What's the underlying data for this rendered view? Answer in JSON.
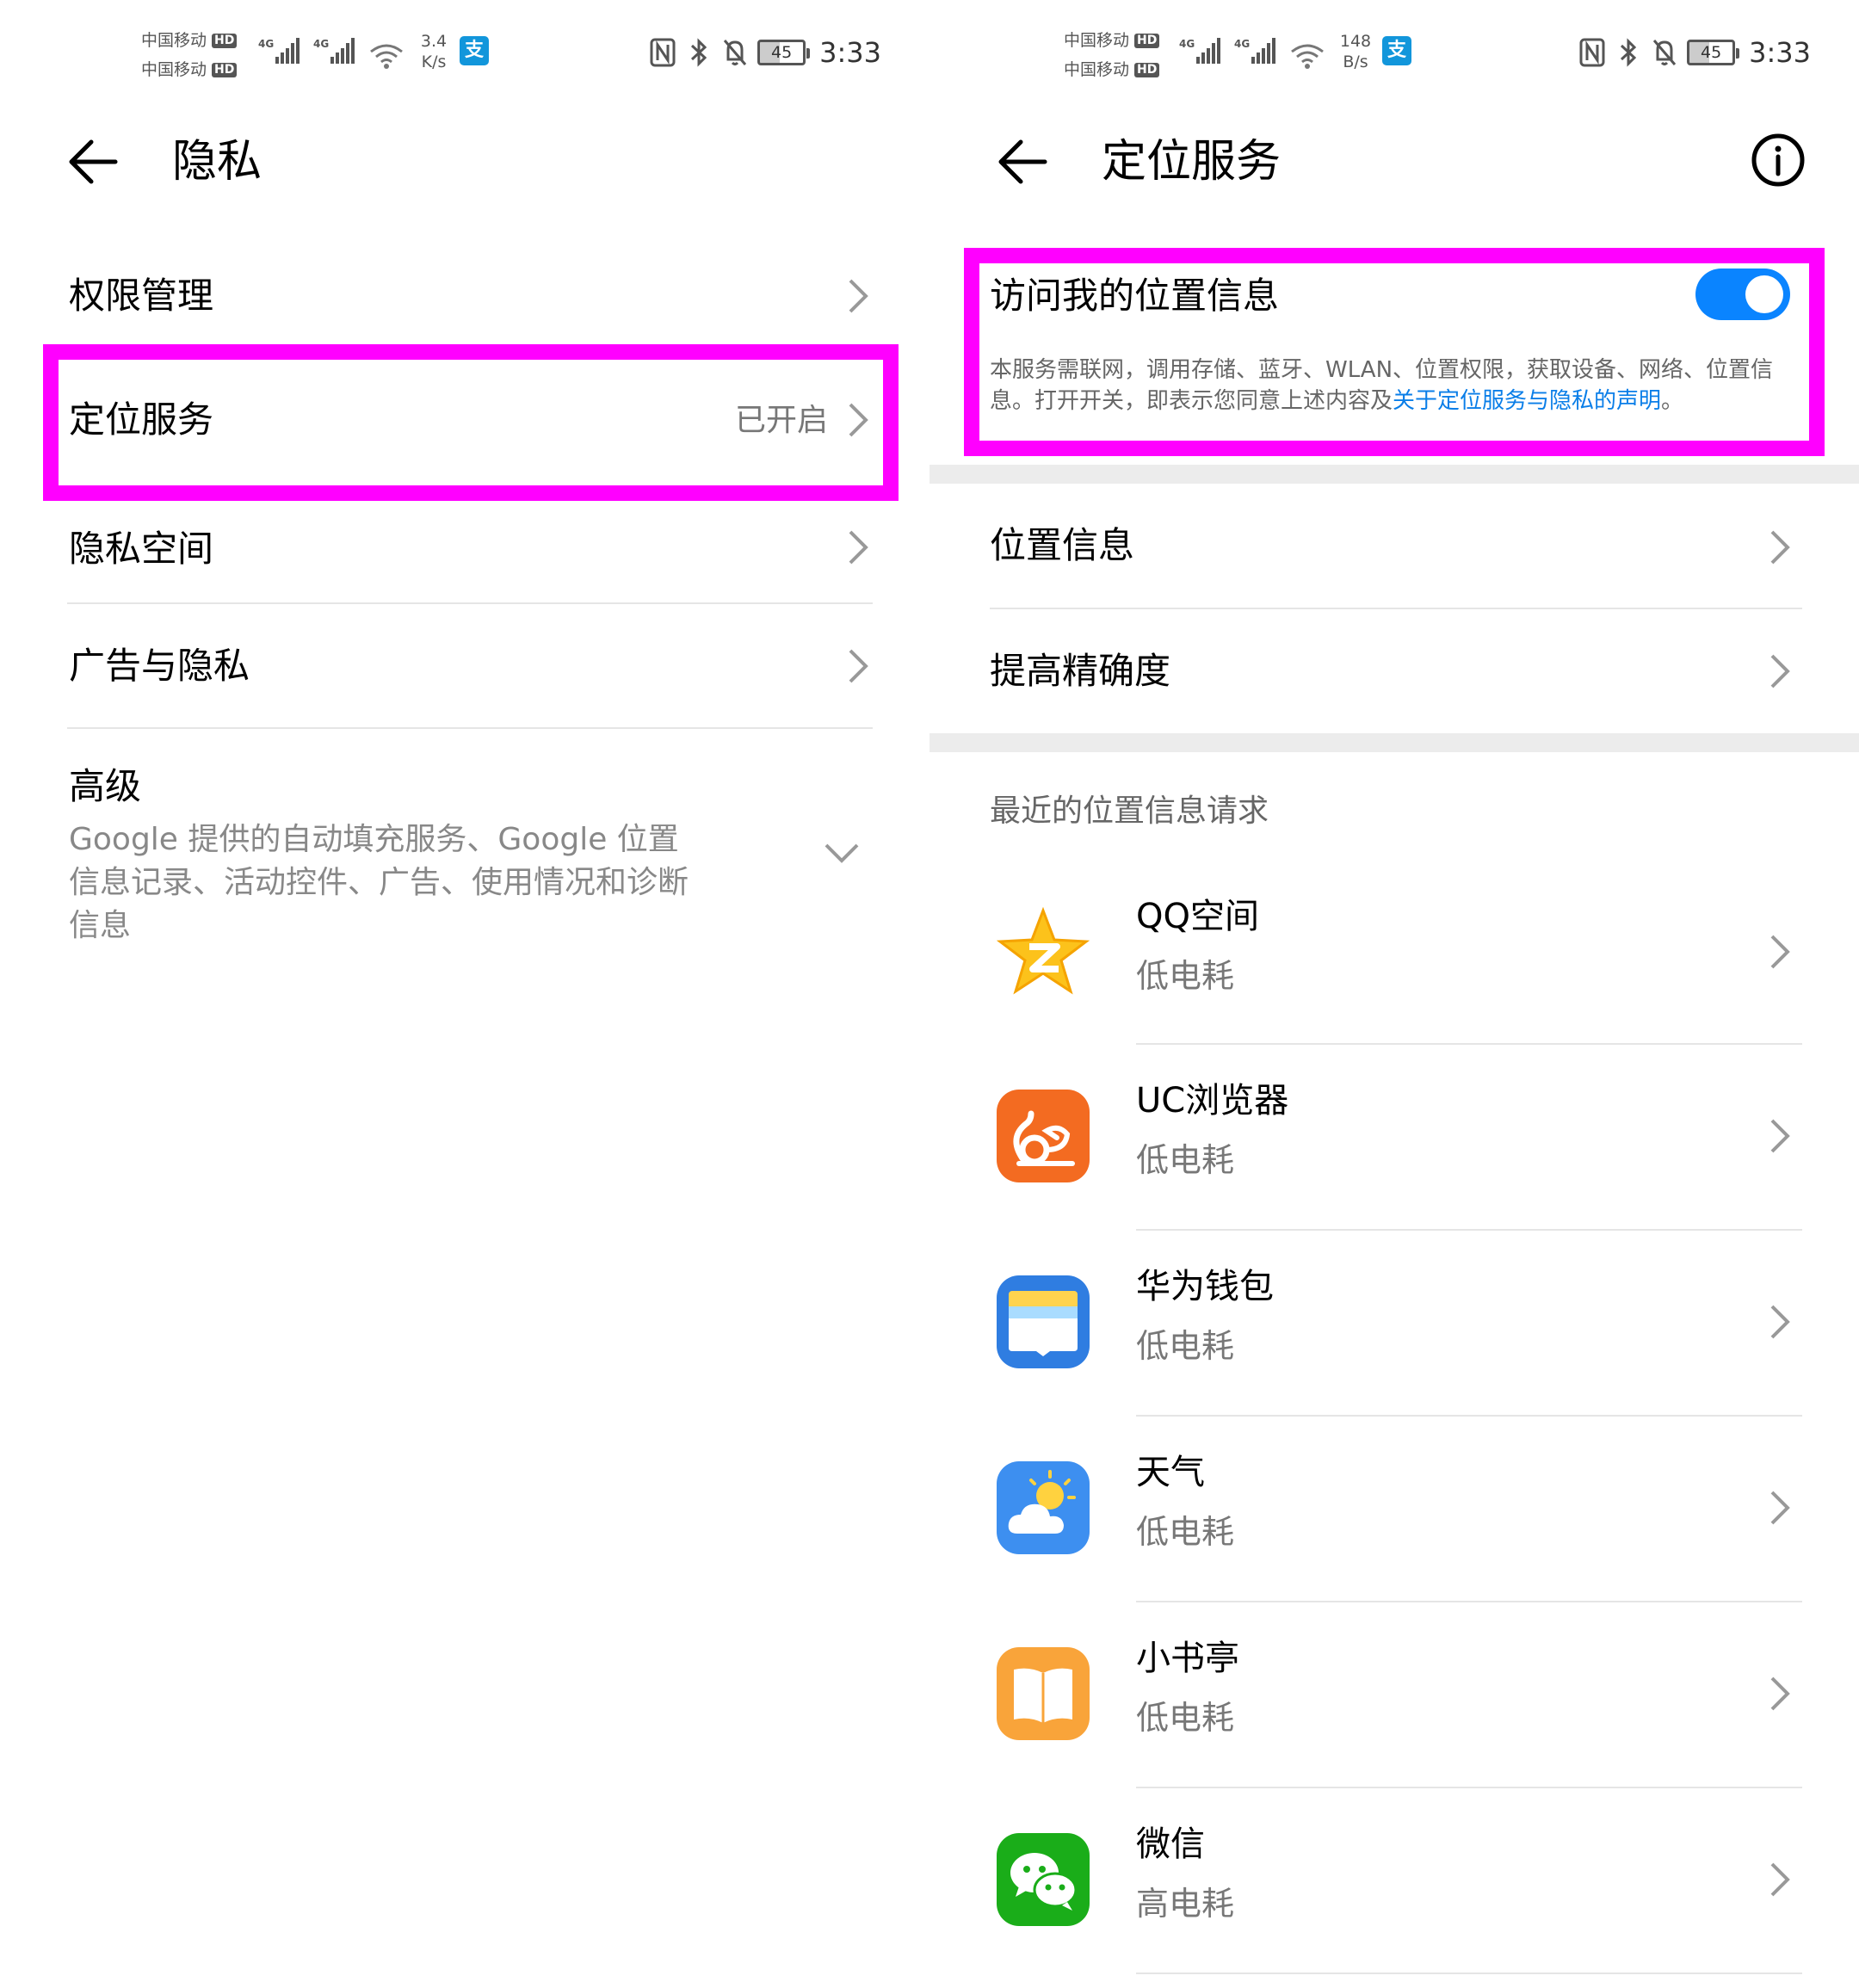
{
  "left": {
    "status": {
      "carrier1": "中国移动",
      "carrier2": "中国移动",
      "hd": "HD",
      "net": "4G",
      "speed_value": "3.4",
      "speed_unit": "K/s",
      "battery": "45",
      "time": "3:33"
    },
    "title": "隐私",
    "items": [
      {
        "label": "权限管理",
        "value": ""
      },
      {
        "label": "定位服务",
        "value": "已开启"
      },
      {
        "label": "隐私空间",
        "value": ""
      },
      {
        "label": "广告与隐私",
        "value": ""
      }
    ],
    "advanced": {
      "label": "高级",
      "lines": [
        "Google 提供的自动填充服务、Google 位置",
        "信息记录、活动控件、广告、使用情况和诊断",
        "信息"
      ]
    }
  },
  "right": {
    "status": {
      "carrier1": "中国移动",
      "carrier2": "中国移动",
      "hd": "HD",
      "net": "4G",
      "speed_value": "148",
      "speed_unit": "B/s",
      "battery": "45",
      "time": "3:33"
    },
    "title": "定位服务",
    "toggle": {
      "label": "访问我的位置信息",
      "state": "on",
      "desc_text": "本服务需联网，调用存储、蓝牙、WLAN、位置权限，获取设备、网络、位置信息。打开开关，即表示您同意上述内容及",
      "desc_link": "关于定位服务与隐私的声明",
      "desc_end": "。"
    },
    "items": [
      {
        "label": "位置信息"
      },
      {
        "label": "提高精确度"
      }
    ],
    "recent_header": "最近的位置信息请求",
    "apps": [
      {
        "name": "QQ空间",
        "power": "低电耗",
        "icon": "qzone-icon"
      },
      {
        "name": "UC浏览器",
        "power": "低电耗",
        "icon": "uc-browser-icon"
      },
      {
        "name": "华为钱包",
        "power": "低电耗",
        "icon": "huawei-wallet-icon"
      },
      {
        "name": "天气",
        "power": "低电耗",
        "icon": "weather-icon"
      },
      {
        "name": "小书亭",
        "power": "低电耗",
        "icon": "xiaoshuting-icon"
      },
      {
        "name": "微信",
        "power": "高电耗",
        "icon": "wechat-icon"
      }
    ]
  },
  "colors": {
    "highlight": "#ff00ff",
    "toggle_on": "#0a84ff",
    "link": "#0a7ee8"
  }
}
